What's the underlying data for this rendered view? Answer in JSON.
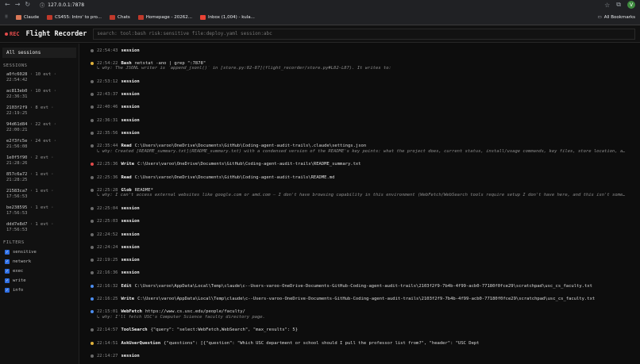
{
  "browser": {
    "url": "127.0.0.1:7878",
    "profile_initial": "V",
    "bookmarks": [
      {
        "label": "Claude",
        "color": "#d97757"
      },
      {
        "label": "CS455: Intro' to pro...",
        "color": "#c0392b"
      },
      {
        "label": "Chats",
        "color": "#c0392b"
      },
      {
        "label": "Homepage - 20262...",
        "color": "#c0392b"
      },
      {
        "label": "Inbox (1,004) - kula...",
        "color": "#ea4335"
      }
    ],
    "all_bookmarks": "All Bookmarks"
  },
  "app": {
    "rec_label": "REC",
    "title": "Flight Recorder",
    "search_placeholder": "search: tool:bash risk:sensitive file:deploy.yaml session:abc"
  },
  "sidebar": {
    "all_sessions": "All sessions",
    "sessions_heading": "SESSIONS",
    "sessions": [
      {
        "id": "a0fc6028",
        "count": "· 10 evt ·",
        "time": "22:54:42"
      },
      {
        "id": "ac813eb0",
        "count": "· 10 evt ·",
        "time": "22:36:31"
      },
      {
        "id": "2103f2f9",
        "count": "· 8 evt ·",
        "time": "22:19:25"
      },
      {
        "id": "94d61d84",
        "count": "· 22 evt ·",
        "time": "22:00:21"
      },
      {
        "id": "e2f3fc5e",
        "count": "· 24 evt ·",
        "time": "21:56:08"
      },
      {
        "id": "1e0f5f90",
        "count": "· 2 evt ·",
        "time": "21:28:26"
      },
      {
        "id": "857c6a72",
        "count": "· 1 evt ·",
        "time": "21:28:25"
      },
      {
        "id": "21583ca7",
        "count": "· 1 evt ·",
        "time": "17:56:53"
      },
      {
        "id": "be238595",
        "count": "· 1 evt ·",
        "time": "17:56:53"
      },
      {
        "id": "ddd7e8d7",
        "count": "· 1 evt ·",
        "time": "17:56:53"
      }
    ],
    "filters_heading": "FILTERS",
    "filters": [
      {
        "label": "sensitive",
        "checked": true
      },
      {
        "label": "network",
        "checked": true
      },
      {
        "label": "exec",
        "checked": true
      },
      {
        "label": "write",
        "checked": true
      },
      {
        "label": "info",
        "checked": true
      }
    ]
  },
  "colors": {
    "info": "#6b6b6b",
    "exec": "#e0b23c",
    "write": "#4c8ef0",
    "sensitive": "#e24b4b"
  },
  "events": [
    {
      "time": "22:54:43",
      "tool": "session",
      "detail": "",
      "why": "",
      "risk": "info"
    },
    {
      "time": "22:54:22",
      "tool": "Bash",
      "detail": "netstat -ano | grep \":7878\"",
      "why": "↳ why: The JSONL writer is `append_jsonl()` in [store.py:82-87](flight_recorder/store.py#L82-L87). It writes to:",
      "risk": "exec"
    },
    {
      "time": "22:53:12",
      "tool": "session",
      "detail": "",
      "why": "",
      "risk": "info"
    },
    {
      "time": "22:43:37",
      "tool": "session",
      "detail": "",
      "why": "",
      "risk": "info"
    },
    {
      "time": "22:40:46",
      "tool": "session",
      "detail": "",
      "why": "",
      "risk": "info"
    },
    {
      "time": "22:36:31",
      "tool": "session",
      "detail": "",
      "why": "",
      "risk": "info"
    },
    {
      "time": "22:35:56",
      "tool": "session",
      "detail": "",
      "why": "",
      "risk": "info"
    },
    {
      "time": "22:35:44",
      "tool": "Read",
      "detail": "C:\\Users\\varoo\\OneDrive\\Documents\\GitHub\\Coding-agent-audit-trails\\.claude\\settings.json",
      "why": "↳ why: Created [README_summary.txt](README_summary.txt) with a condensed version of the README's key points: what the project does, current status, install/usage commands, key files, store location, a…",
      "risk": "info"
    },
    {
      "time": "22:25:36",
      "tool": "Write",
      "detail": "C:\\Users\\varoo\\OneDrive\\Documents\\GitHub\\Coding-agent-audit-trails\\README_summary.txt",
      "why": "",
      "risk": "sensitive"
    },
    {
      "time": "22:25:36",
      "tool": "Read",
      "detail": "C:\\Users\\varoo\\OneDrive\\Documents\\GitHub\\Coding-agent-audit-trails\\README.md",
      "why": "",
      "risk": "info"
    },
    {
      "time": "22:25:28",
      "tool": "Glob",
      "detail": "README*",
      "why": "↳ why: I can't access external websites like google.com or amd.com — I don't have browsing capability in this environment (WebFetch/WebSearch tools require setup I don't have here, and this isn't some…",
      "risk": "info"
    },
    {
      "time": "22:25:04",
      "tool": "session",
      "detail": "",
      "why": "",
      "risk": "info"
    },
    {
      "time": "22:25:03",
      "tool": "session",
      "detail": "",
      "why": "",
      "risk": "info"
    },
    {
      "time": "22:24:52",
      "tool": "session",
      "detail": "",
      "why": "",
      "risk": "info"
    },
    {
      "time": "22:24:24",
      "tool": "session",
      "detail": "",
      "why": "",
      "risk": "info"
    },
    {
      "time": "22:19:25",
      "tool": "session",
      "detail": "",
      "why": "",
      "risk": "info"
    },
    {
      "time": "22:16:36",
      "tool": "session",
      "detail": "",
      "why": "",
      "risk": "info"
    },
    {
      "time": "22:16:32",
      "tool": "Edit",
      "detail": "C:\\Users\\varoo\\AppData\\Local\\Temp\\claude\\c--Users-varoo-OneDrive-Documents-GitHub-Coding-agent-audit-trails\\2103f2f9-7b4b-4f99-acb0-77180f0fce29\\scratchpad\\usc_cs_faculty.txt",
      "why": "",
      "risk": "write"
    },
    {
      "time": "22:16:25",
      "tool": "Write",
      "detail": "C:\\Users\\varoo\\AppData\\Local\\Temp\\claude\\c--Users-varoo-OneDrive-Documents-GitHub-Coding-agent-audit-trails\\2103f2f9-7b4b-4f99-acb0-77180f0fce29\\scratchpad\\usc_cs_faculty.txt",
      "why": "",
      "risk": "write"
    },
    {
      "time": "22:15:01",
      "tool": "WebFetch",
      "detail": "https://www.cs.usc.edu/people/faculty/",
      "why": "↳ why: I'll fetch USC's Computer Science faculty directory page.",
      "risk": "write"
    },
    {
      "time": "22:14:57",
      "tool": "ToolSearch",
      "detail": "{\"query\": \"select:WebFetch,WebSearch\", \"max_results\": 5}",
      "why": "",
      "risk": "info"
    },
    {
      "time": "22:14:51",
      "tool": "AskUserQuestion",
      "detail": "{\"questions\": [{\"question\": \"Which USC department or school should I pull the professor list from?\", \"header\": \"USC Dept",
      "why": "",
      "risk": "exec"
    },
    {
      "time": "22:14:27",
      "tool": "session",
      "detail": "",
      "why": "",
      "risk": "info"
    }
  ]
}
